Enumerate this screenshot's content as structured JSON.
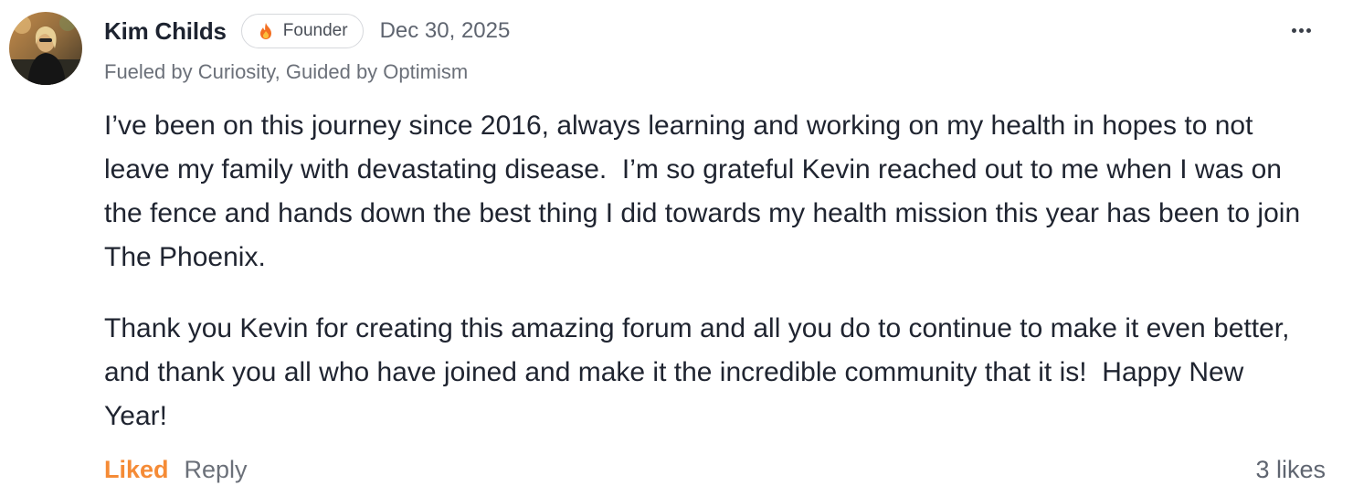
{
  "post": {
    "author_name": "Kim Childs",
    "badge": {
      "label": "Founder",
      "icon": "flame-icon",
      "icon_color": "#f36f21"
    },
    "date": "Dec 30, 2025",
    "tagline": "Fueled by Curiosity, Guided by Optimism",
    "avatar": "profile-photo",
    "menu_icon": "more-horizontal-icon",
    "body": {
      "paragraph_1": "I’ve been on this journey since 2016, always learning and working on my health in hopes to not leave my family with devastating disease.  I’m so grateful Kevin reached out to me when I was on the fence and hands down the best thing I did towards my health mission this year has been to join The Phoenix.",
      "paragraph_2": "Thank you Kevin for creating this amazing forum and all you do to continue to make it even better, and thank you all who have joined and make it the incredible community that it is!  Happy New Year!"
    },
    "actions": {
      "liked_label": "Liked",
      "reply_label": "Reply",
      "likes_count": "3 likes"
    }
  },
  "colors": {
    "accent": "#f58b36",
    "text": "#1f2430",
    "muted": "#6b7079"
  }
}
